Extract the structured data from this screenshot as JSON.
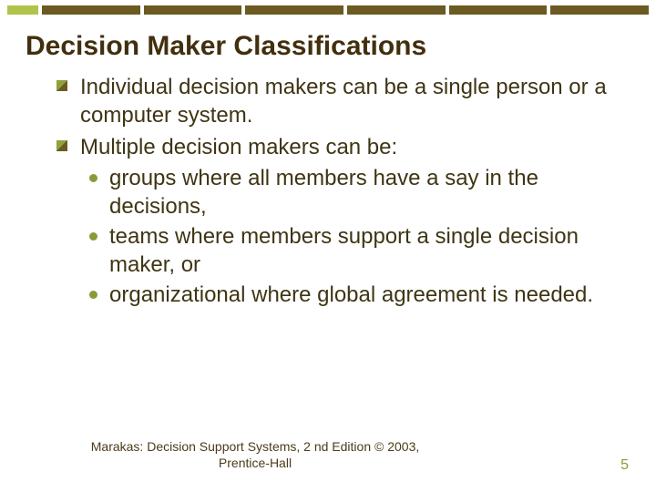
{
  "title": "Decision Maker Classifications",
  "bullets": [
    {
      "text": "Individual decision makers can be a single person or a computer system."
    },
    {
      "text": "Multiple decision makers can be:",
      "sub": [
        {
          "lead": "groups",
          "rest": " where all members have a say in the decisions,"
        },
        {
          "lead": "teams",
          "rest": " where members support a single decision maker, or"
        },
        {
          "lead": "organizational",
          "rest": " where global agreement is needed."
        }
      ]
    }
  ],
  "footer": {
    "line1": "Marakas: Decision Support Systems, 2 nd Edition  © 2003,",
    "line2": "Prentice-Hall"
  },
  "page_number": "5"
}
